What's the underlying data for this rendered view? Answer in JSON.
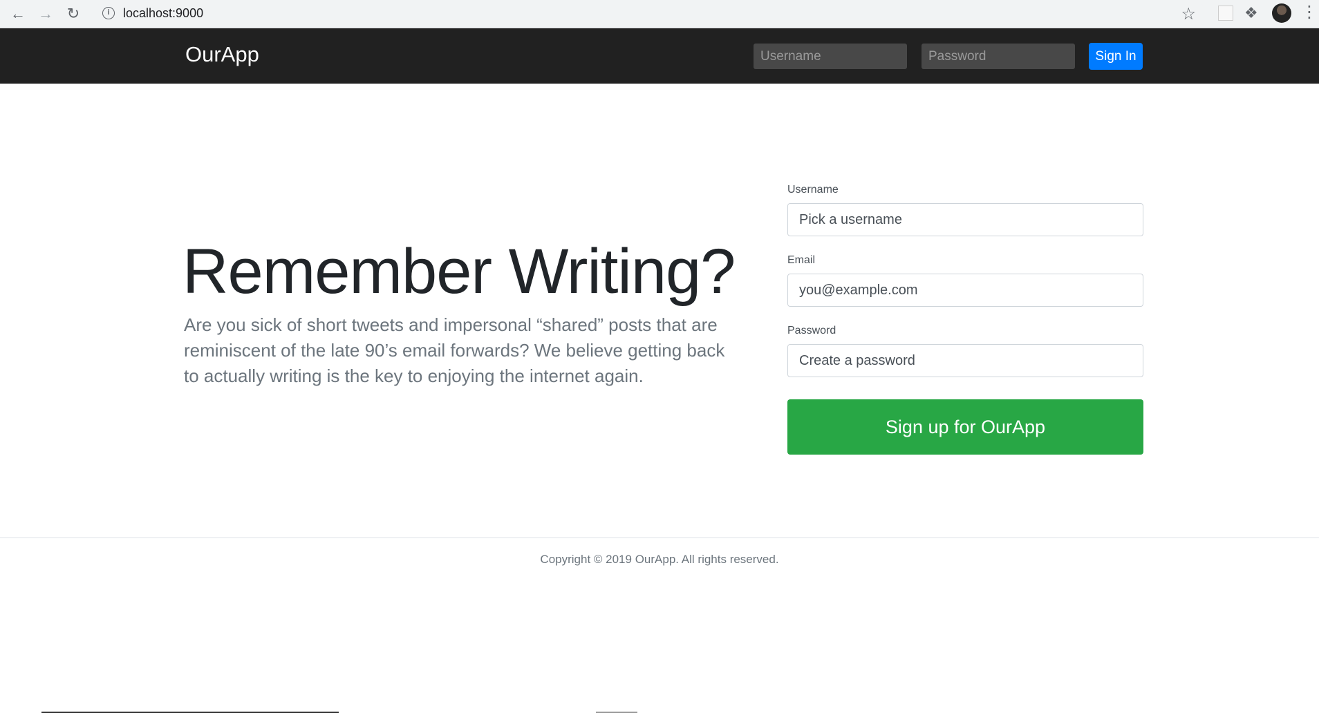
{
  "browser": {
    "url": "localhost:9000",
    "icons": {
      "back": "arrow-left-icon",
      "forward": "arrow-right-icon",
      "reload": "reload-icon",
      "info": "info-icon",
      "bookmark": "star-icon",
      "extensions": "puzzle-icon",
      "menu": "kebab-menu-icon"
    }
  },
  "header": {
    "brand": "OurApp",
    "username_placeholder": "Username",
    "password_placeholder": "Password",
    "signin_label": "Sign In",
    "signin_color": "#007bff",
    "background": "#212121"
  },
  "hero": {
    "title": "Remember Writing?",
    "lead": "Are you sick of short tweets and impersonal “shared” posts that are reminiscent of the late 90’s email forwards? We believe getting back to actually writing is the key to enjoying the internet again."
  },
  "signup_form": {
    "username_label": "Username",
    "username_placeholder": "Pick a username",
    "email_label": "Email",
    "email_placeholder": "you@example.com",
    "password_label": "Password",
    "password_placeholder": "Create a password",
    "submit_label": "Sign up for OurApp",
    "submit_color": "#28a745"
  },
  "footer": {
    "text": "Copyright © 2019 OurApp. All rights reserved."
  }
}
